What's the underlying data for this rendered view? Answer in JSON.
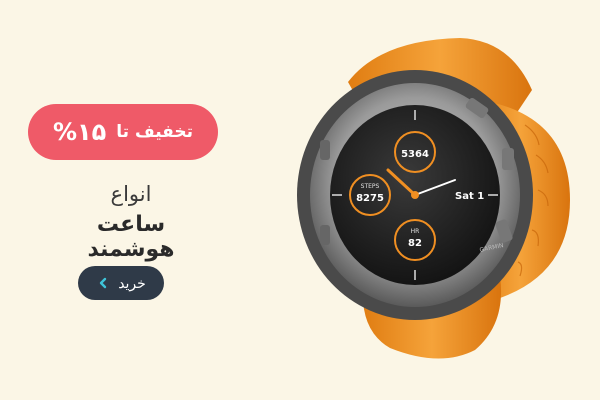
{
  "promo": {
    "discount_label": "تخفیف تا",
    "discount_value": "%۱۵",
    "headline_line1": "انواع",
    "headline_line2": "ساعت هوشمند",
    "buy_button_label": "خرید"
  },
  "watch_face": {
    "top_subdial_value": "5364",
    "left_subdial_label": "STEPS",
    "left_subdial_value": "8275",
    "right_date": "Sat 1",
    "bottom_subdial_label": "HR",
    "bottom_subdial_value": "82",
    "brand": "GARMIN"
  },
  "colors": {
    "background": "#fbf6e6",
    "discount_pill": "#ef5a68",
    "buy_button": "#2f3a48",
    "strap": "#f08f22",
    "dial_accent": "#f08f22"
  },
  "icons": {
    "buy_chevron": "chevron-left-icon"
  }
}
